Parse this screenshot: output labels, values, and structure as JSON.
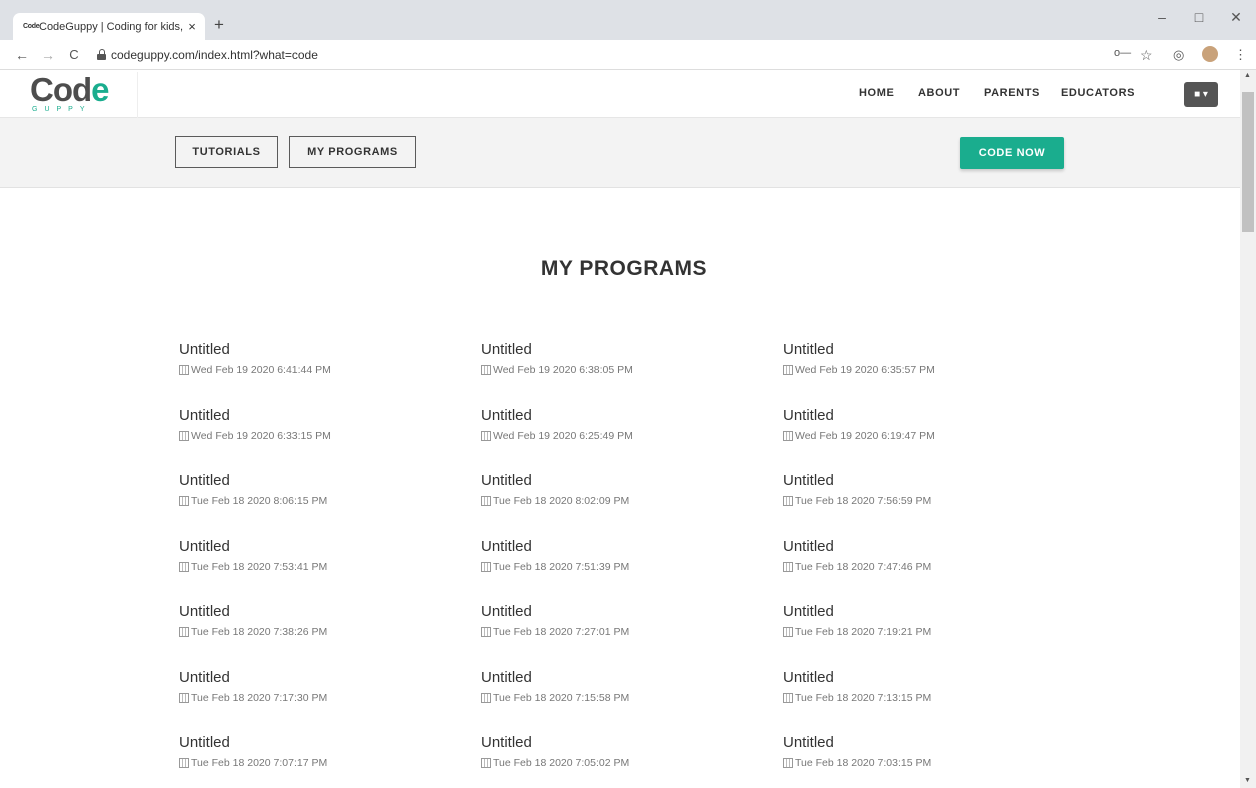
{
  "browser": {
    "tab_favicon": "Code",
    "tab_title": "CodeGuppy | Coding for kids, tee",
    "tab_close": "×",
    "new_tab": "+",
    "url": "codeguppy.com/index.html?what=code",
    "window": {
      "minimize": "–",
      "maximize": "□",
      "close": "✕"
    },
    "nav": {
      "back": "←",
      "forward": "→",
      "reload": "C"
    },
    "toolbar_icons": {
      "key": "o⁠—",
      "star": "☆",
      "extension": "◎",
      "menu": "⋮"
    }
  },
  "site": {
    "logo_main": "Cod",
    "logo_e": "e",
    "logo_sub": "GUPPY",
    "nav_links": [
      "HOME",
      "ABOUT",
      "PARENTS",
      "EDUCATORS"
    ],
    "user_button": "▾",
    "subnav": {
      "tutorials": "TUTORIALS",
      "my_programs": "MY PROGRAMS",
      "code_now": "CODE NOW"
    }
  },
  "main": {
    "heading": "MY PROGRAMS",
    "programs": [
      {
        "title": "Untitled",
        "date": "Wed Feb 19 2020 6:41:44 PM"
      },
      {
        "title": "Untitled",
        "date": "Wed Feb 19 2020 6:38:05 PM"
      },
      {
        "title": "Untitled",
        "date": "Wed Feb 19 2020 6:35:57 PM"
      },
      {
        "title": "Untitled",
        "date": "Wed Feb 19 2020 6:33:15 PM"
      },
      {
        "title": "Untitled",
        "date": "Wed Feb 19 2020 6:25:49 PM"
      },
      {
        "title": "Untitled",
        "date": "Wed Feb 19 2020 6:19:47 PM"
      },
      {
        "title": "Untitled",
        "date": "Tue Feb 18 2020 8:06:15 PM"
      },
      {
        "title": "Untitled",
        "date": "Tue Feb 18 2020 8:02:09 PM"
      },
      {
        "title": "Untitled",
        "date": "Tue Feb 18 2020 7:56:59 PM"
      },
      {
        "title": "Untitled",
        "date": "Tue Feb 18 2020 7:53:41 PM"
      },
      {
        "title": "Untitled",
        "date": "Tue Feb 18 2020 7:51:39 PM"
      },
      {
        "title": "Untitled",
        "date": "Tue Feb 18 2020 7:47:46 PM"
      },
      {
        "title": "Untitled",
        "date": "Tue Feb 18 2020 7:38:26 PM"
      },
      {
        "title": "Untitled",
        "date": "Tue Feb 18 2020 7:27:01 PM"
      },
      {
        "title": "Untitled",
        "date": "Tue Feb 18 2020 7:19:21 PM"
      },
      {
        "title": "Untitled",
        "date": "Tue Feb 18 2020 7:17:30 PM"
      },
      {
        "title": "Untitled",
        "date": "Tue Feb 18 2020 7:15:58 PM"
      },
      {
        "title": "Untitled",
        "date": "Tue Feb 18 2020 7:13:15 PM"
      },
      {
        "title": "Untitled",
        "date": "Tue Feb 18 2020 7:07:17 PM"
      },
      {
        "title": "Untitled",
        "date": "Tue Feb 18 2020 7:05:02 PM"
      },
      {
        "title": "Untitled",
        "date": "Tue Feb 18 2020 7:03:15 PM"
      }
    ]
  },
  "colors": {
    "accent": "#1aad8e",
    "text": "#333333",
    "muted": "#777777"
  }
}
